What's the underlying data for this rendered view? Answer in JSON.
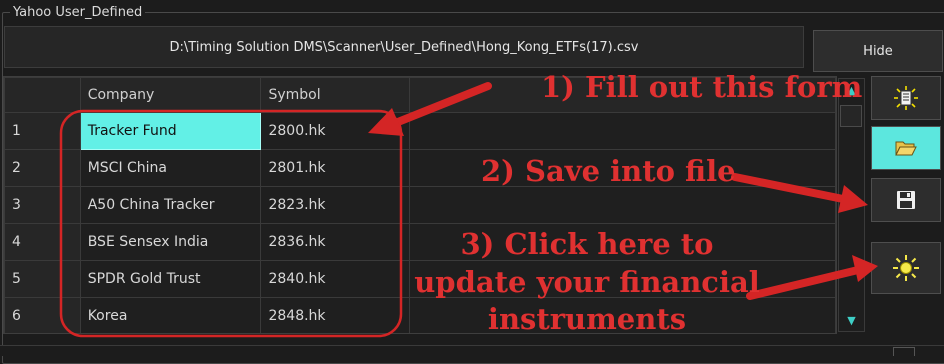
{
  "group": {
    "title": "Yahoo User_Defined"
  },
  "path_bar": {
    "text": "D:\\Timing Solution DMS\\Scanner\\User_Defined\\Hong_Kong_ETFs(17).csv"
  },
  "hide_button": {
    "label": "Hide"
  },
  "grid": {
    "columns": [
      "Company",
      "Symbol"
    ],
    "rows": [
      {
        "num": "1",
        "company": "Tracker Fund",
        "symbol": "2800.hk"
      },
      {
        "num": "2",
        "company": "MSCI China",
        "symbol": "2801.hk"
      },
      {
        "num": "3",
        "company": "A50 China Tracker",
        "symbol": "2823.hk"
      },
      {
        "num": "4",
        "company": "BSE Sensex India",
        "symbol": "2836.hk"
      },
      {
        "num": "5",
        "company": "SPDR Gold Trust",
        "symbol": "2840.hk"
      },
      {
        "num": "6",
        "company": "Korea",
        "symbol": "2848.hk"
      }
    ]
  },
  "scrollbar": {
    "up_icon": "arrow-up-icon",
    "down_icon": "arrow-down-icon"
  },
  "toolbar": {
    "buttons": [
      {
        "name": "new-button",
        "icon": "sparkle-document-icon"
      },
      {
        "name": "open-button",
        "icon": "folder-open-icon"
      },
      {
        "name": "save-button",
        "icon": "floppy-disk-icon"
      },
      {
        "name": "update-button",
        "icon": "sun-icon"
      }
    ]
  },
  "annotations": {
    "step1": "1) Fill out this form",
    "step2": "2) Save into file",
    "step3_line1": "3) Click here to",
    "step3_line2": "update your financial",
    "step3_line3": "instruments"
  },
  "colors": {
    "annotation_red": "#e03131",
    "selected_cell": "#62f0e6",
    "active_button": "#5ce7de",
    "background": "#1c1c1c"
  }
}
